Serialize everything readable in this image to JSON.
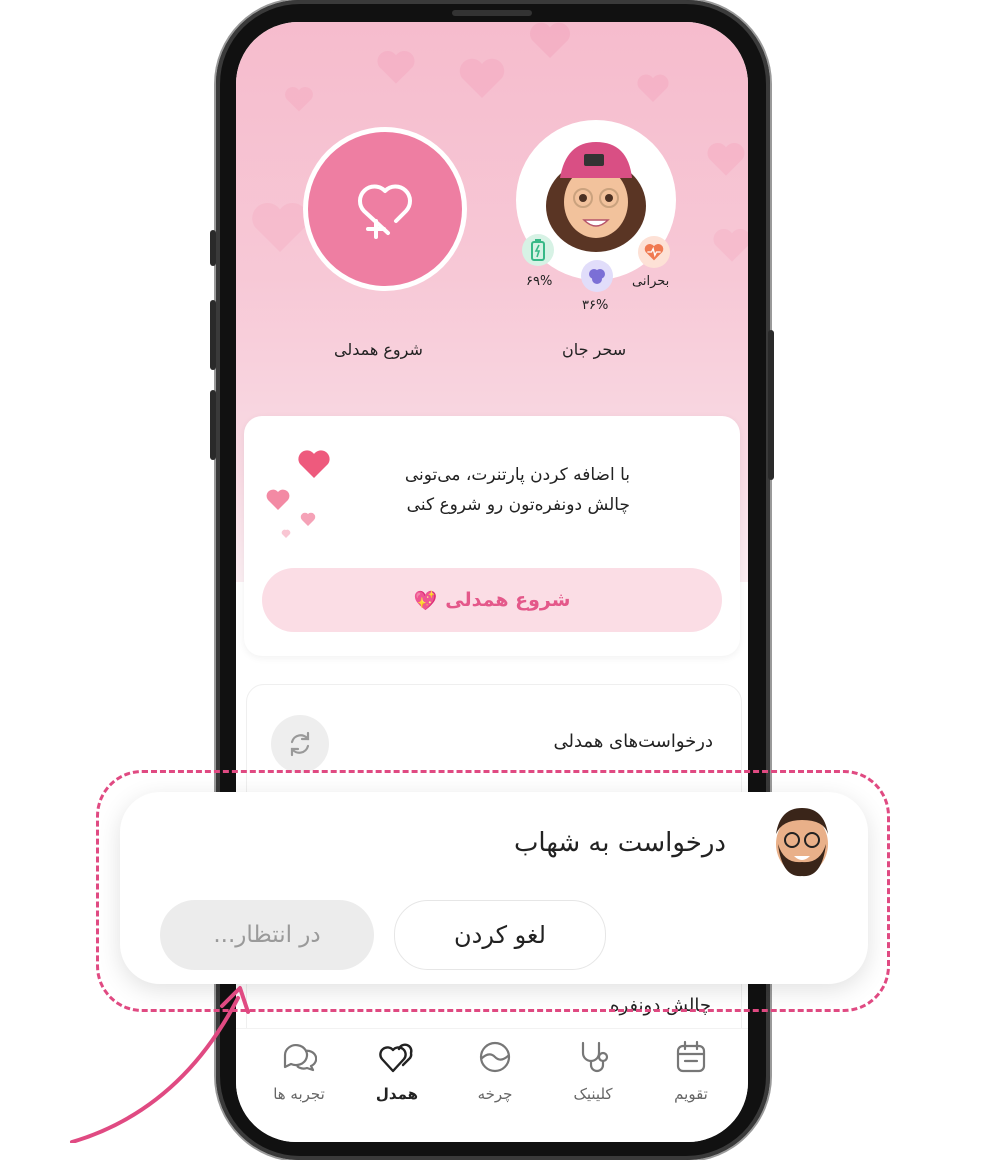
{
  "profile": {
    "name": "سحر جان",
    "battery_value": "۶۹%",
    "brain_value": "۳۶%",
    "heart_status": "بحرانی"
  },
  "partner": {
    "add_label": "شروع همدلی"
  },
  "invite_card": {
    "line1": "با اضافه کردن پارتنرت، می‌تونی",
    "line2": "چالش دونفره‌تون رو شروع کنی",
    "button_label": "شروع همدلی",
    "button_emoji": "💖"
  },
  "requests": {
    "title": "درخواست‌های همدلی",
    "partial_item": "چالش دونفره"
  },
  "request_popup": {
    "title": "درخواست به شهاب",
    "cancel_label": "لغو کردن",
    "status_label": "در انتظار..."
  },
  "tabbar": {
    "tabs": [
      {
        "label": "تقویم",
        "icon": "calendar-icon"
      },
      {
        "label": "کلینیک",
        "icon": "stethoscope-icon"
      },
      {
        "label": "چرخه",
        "icon": "cycle-icon"
      },
      {
        "label": "همدل",
        "icon": "hearts-icon",
        "active": true
      },
      {
        "label": "تجربه ها",
        "icon": "chat-bubbles-icon"
      }
    ]
  },
  "colors": {
    "accent": "#e4588a",
    "accent_soft": "#fbdde5",
    "hero_pink": "#f6bccd",
    "dash": "#e04a82"
  }
}
